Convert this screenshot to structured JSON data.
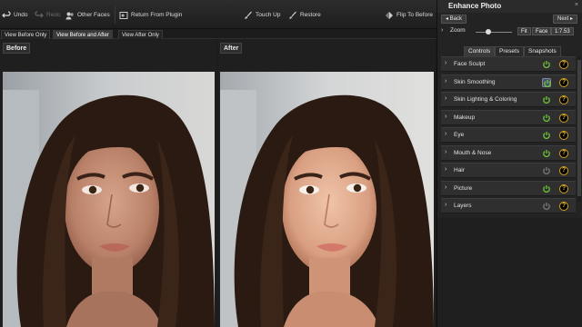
{
  "toolbar": {
    "undo": "Undo",
    "redo": "Redo",
    "other_faces": "Other Faces",
    "return_from_plugin": "Return From Plugin",
    "touch_up": "Touch Up",
    "restore": "Restore",
    "flip_to_before": "Flip To Before"
  },
  "view_tabs": [
    "View Before Only",
    "View Before and After",
    "View After Only"
  ],
  "active_view_tab": "View Before and After",
  "panes": {
    "before_label": "Before",
    "after_label": "After"
  },
  "panel": {
    "title": "Enhance Photo",
    "close": "×",
    "back": "◂ Back",
    "next": "Next ▸",
    "zoom_label": "Zoom",
    "zoom_level": 0.35,
    "zoom_fit": "Fit",
    "zoom_face": "Face",
    "zoom_ratio": "1:7.53",
    "tabs": [
      "Controls",
      "Presets",
      "Snapshots"
    ],
    "active_tab": "Controls",
    "items": [
      {
        "label": "Face Sculpt",
        "enabled": true
      },
      {
        "label": "Skin Smoothing",
        "enabled": true,
        "selected": true
      },
      {
        "label": "Skin Lighting & Coloring",
        "enabled": true
      },
      {
        "label": "Makeup",
        "enabled": true
      },
      {
        "label": "Eye",
        "enabled": true
      },
      {
        "label": "Mouth & Nose",
        "enabled": true
      },
      {
        "label": "Hair",
        "enabled": false
      },
      {
        "label": "Picture",
        "enabled": true
      },
      {
        "label": "Layers",
        "enabled": false
      }
    ],
    "help_glyph": "?"
  },
  "colors": {
    "power_on": "#6fc23a",
    "power_off": "#777777",
    "help_ring": "#d4a21a"
  }
}
